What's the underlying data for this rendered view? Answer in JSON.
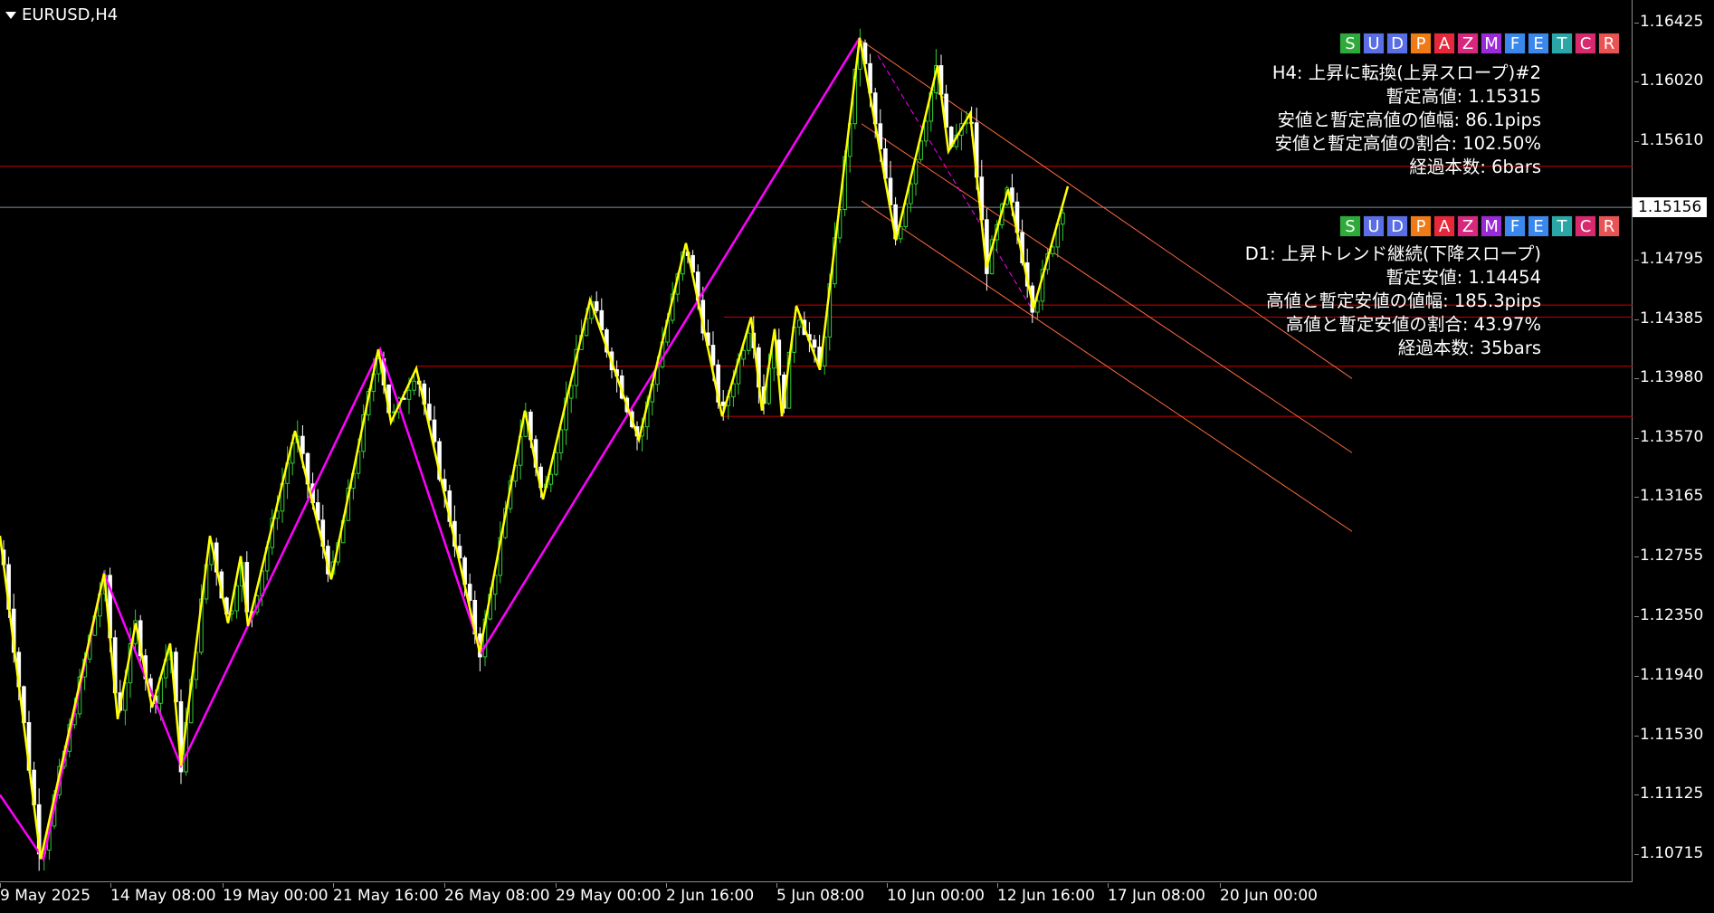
{
  "symbol_label": "EURUSD,H4",
  "ea_buttons": [
    {
      "label": "S",
      "color": "#2eaa3a"
    },
    {
      "label": "U",
      "color": "#5a6ee6"
    },
    {
      "label": "D",
      "color": "#5a6ee6"
    },
    {
      "label": "P",
      "color": "#f07a16"
    },
    {
      "label": "A",
      "color": "#e6283a"
    },
    {
      "label": "Z",
      "color": "#d8287e"
    },
    {
      "label": "M",
      "color": "#9b2ad8"
    },
    {
      "label": "F",
      "color": "#3a88ee"
    },
    {
      "label": "E",
      "color": "#3a88ee"
    },
    {
      "label": "T",
      "color": "#2aa6a6"
    },
    {
      "label": "C",
      "color": "#d8286e"
    },
    {
      "label": "R",
      "color": "#e85454"
    }
  ],
  "info_h4": {
    "title": "H4: 上昇に転換(上昇スロープ)#2",
    "line1": "暫定高値: 1.15315",
    "line2": "安値と暫定高値の値幅: 86.1pips",
    "line3": "安値と暫定高値の割合: 102.50%",
    "line4": "経過本数: 6bars"
  },
  "info_d1": {
    "title": "D1: 上昇トレンド継続(下降スロープ)",
    "line1": "暫定安値: 1.14454",
    "line2": "高値と暫定安値の値幅: 185.3pips",
    "line3": "高値と暫定安値の割合: 43.97%",
    "line4": "経過本数: 35bars"
  },
  "price_axis": [
    "1.16425",
    "1.16020",
    "1.15610",
    "1.14795",
    "1.14385",
    "1.13980",
    "1.13570",
    "1.13165",
    "1.12755",
    "1.12350",
    "1.11940",
    "1.11530",
    "1.11125",
    "1.10715"
  ],
  "current_price": "1.15156",
  "time_axis": [
    "9 May 2025",
    "14 May 08:00",
    "19 May 00:00",
    "21 May 16:00",
    "26 May 08:00",
    "29 May 00:00",
    "2 Jun 16:00",
    "5 Jun 08:00",
    "10 Jun 00:00",
    "12 Jun 16:00",
    "17 Jun 08:00",
    "20 Jun 00:00"
  ],
  "colors": {
    "background": "#000000",
    "bull_candle": "#32cd32",
    "bear_candle": "#ffffff",
    "zigzag_h4": "#ffff00",
    "zigzag_d1": "#ff00ff",
    "level_line": "#cc0000",
    "channel_line": "#ff6a40",
    "bid_line": "#8090a0"
  },
  "chart_data": {
    "type": "candlestick",
    "timeframe": "H4",
    "y_range": [
      1.1052,
      1.1658
    ],
    "zigzag_h4": [
      [
        0,
        1.129
      ],
      [
        45,
        1.1068
      ],
      [
        115,
        1.1264
      ],
      [
        130,
        1.1164
      ],
      [
        150,
        1.123
      ],
      [
        168,
        1.1172
      ],
      [
        188,
        1.1216
      ],
      [
        200,
        1.1132
      ],
      [
        232,
        1.129
      ],
      [
        252,
        1.123
      ],
      [
        266,
        1.1276
      ],
      [
        274,
        1.1228
      ],
      [
        326,
        1.1362
      ],
      [
        366,
        1.126
      ],
      [
        418,
        1.1418
      ],
      [
        432,
        1.1368
      ],
      [
        460,
        1.1405
      ],
      [
        530,
        1.121
      ],
      [
        580,
        1.1376
      ],
      [
        600,
        1.1315
      ],
      [
        652,
        1.1452
      ],
      [
        706,
        1.1356
      ],
      [
        758,
        1.1491
      ],
      [
        798,
        1.1372
      ],
      [
        830,
        1.144
      ],
      [
        842,
        1.1376
      ],
      [
        856,
        1.1432
      ],
      [
        864,
        1.1372
      ],
      [
        880,
        1.1448
      ],
      [
        906,
        1.1404
      ],
      [
        950,
        1.1632
      ],
      [
        990,
        1.1493
      ],
      [
        1036,
        1.1613
      ],
      [
        1048,
        1.1554
      ],
      [
        1072,
        1.158
      ],
      [
        1090,
        1.1474
      ],
      [
        1114,
        1.1528
      ],
      [
        1142,
        1.1446
      ],
      [
        1180,
        1.153
      ]
    ],
    "zigzag_d1": [
      [
        0,
        1.1112
      ],
      [
        48,
        1.1068
      ],
      [
        115,
        1.1264
      ],
      [
        200,
        1.1132
      ],
      [
        420,
        1.1418
      ],
      [
        532,
        1.121
      ],
      [
        950,
        1.1632
      ]
    ],
    "levels": [
      1.15438,
      1.14485,
      1.14402,
      1.14064,
      1.1372
    ],
    "channel_lines": [
      [
        [
          952,
          1.163
        ],
        [
          1494,
          1.1398
        ]
      ],
      [
        [
          952,
          1.1573
        ],
        [
          1494,
          1.1347
        ]
      ],
      [
        [
          952,
          1.152
        ],
        [
          1494,
          1.1293
        ]
      ]
    ],
    "bid": 1.15156
  }
}
